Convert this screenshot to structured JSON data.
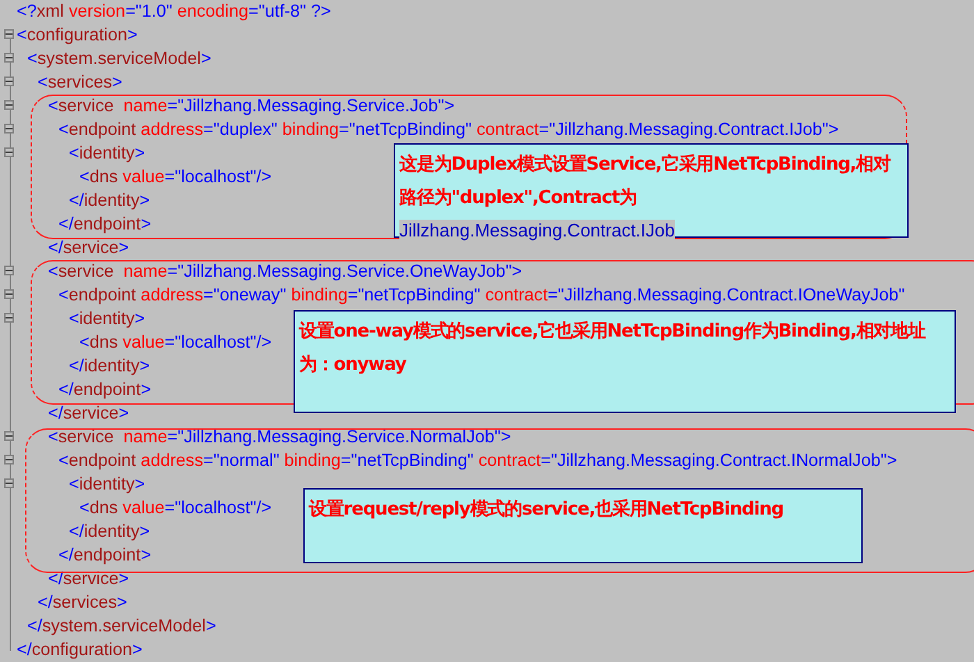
{
  "editor": {
    "lines": [
      {
        "tokens": [
          {
            "kind": "bracket",
            "text": "<?"
          },
          {
            "kind": "tag",
            "text": "xml"
          },
          {
            "kind": "attr",
            "text": " version"
          },
          {
            "kind": "value",
            "text": "=\"1.0\""
          },
          {
            "kind": "attr",
            "text": " encoding"
          },
          {
            "kind": "value",
            "text": "=\"utf-8\""
          },
          {
            "kind": "bracket",
            "text": " ?>"
          }
        ]
      },
      {
        "tokens": [
          {
            "kind": "bracket",
            "text": "<"
          },
          {
            "kind": "tag",
            "text": "configuration"
          },
          {
            "kind": "bracket",
            "text": ">"
          }
        ],
        "expanded": true,
        "children": [
          {
            "tokens": [
              {
                "kind": "bracket",
                "text": "<"
              },
              {
                "kind": "tag",
                "text": "system.serviceModel"
              },
              {
                "kind": "bracket",
                "text": ">"
              }
            ],
            "expanded": true,
            "children": [
              {
                "tokens": [
                  {
                    "kind": "bracket",
                    "text": "<"
                  },
                  {
                    "kind": "tag",
                    "text": "services"
                  },
                  {
                    "kind": "bracket",
                    "text": ">"
                  }
                ],
                "expanded": true,
                "children": [
                  {
                    "tokens": [
                      {
                        "kind": "bracket",
                        "text": "<"
                      },
                      {
                        "kind": "tag",
                        "text": "service"
                      },
                      {
                        "kind": "attr",
                        "text": "  name"
                      },
                      {
                        "kind": "value",
                        "text": "=\"Jillzhang.Messaging.Service.Job\""
                      },
                      {
                        "kind": "bracket",
                        "text": ">"
                      }
                    ],
                    "expanded": true,
                    "children": [
                      {
                        "tokens": [
                          {
                            "kind": "bracket",
                            "text": "<"
                          },
                          {
                            "kind": "tag",
                            "text": "endpoint"
                          },
                          {
                            "kind": "attr",
                            "text": " address"
                          },
                          {
                            "kind": "value",
                            "text": "=\"duplex\""
                          },
                          {
                            "kind": "attr",
                            "text": " binding"
                          },
                          {
                            "kind": "value",
                            "text": "=\"netTcpBinding\""
                          },
                          {
                            "kind": "attr",
                            "text": " contract"
                          },
                          {
                            "kind": "value",
                            "text": "=\"Jillzhang.Messaging.Contract.IJob\""
                          },
                          {
                            "kind": "bracket",
                            "text": ">"
                          }
                        ],
                        "expanded": true,
                        "children": [
                          {
                            "tokens": [
                              {
                                "kind": "bracket",
                                "text": "<"
                              },
                              {
                                "kind": "tag",
                                "text": "identity"
                              },
                              {
                                "kind": "bracket",
                                "text": ">"
                              }
                            ],
                            "expanded": true,
                            "children": [
                              {
                                "tokens": [
                                  {
                                    "kind": "bracket",
                                    "text": "<"
                                  },
                                  {
                                    "kind": "tag",
                                    "text": "dns"
                                  },
                                  {
                                    "kind": "attr",
                                    "text": " value"
                                  },
                                  {
                                    "kind": "value",
                                    "text": "=\"localhost\""
                                  },
                                  {
                                    "kind": "bracket",
                                    "text": "/>"
                                  }
                                ]
                              }
                            ]
                          },
                          {
                            "tokens": [
                              {
                                "kind": "bracket",
                                "text": "</"
                              },
                              {
                                "kind": "tag",
                                "text": "identity"
                              },
                              {
                                "kind": "bracket",
                                "text": ">"
                              }
                            ]
                          }
                        ]
                      },
                      {
                        "tokens": [
                          {
                            "kind": "bracket",
                            "text": "</"
                          },
                          {
                            "kind": "tag",
                            "text": "endpoint"
                          },
                          {
                            "kind": "bracket",
                            "text": ">"
                          }
                        ]
                      }
                    ]
                  },
                  {
                    "tokens": [
                      {
                        "kind": "bracket",
                        "text": "</"
                      },
                      {
                        "kind": "tag",
                        "text": "service"
                      },
                      {
                        "kind": "bracket",
                        "text": ">"
                      }
                    ]
                  },
                  {
                    "tokens": [
                      {
                        "kind": "bracket",
                        "text": "<"
                      },
                      {
                        "kind": "tag",
                        "text": "service"
                      },
                      {
                        "kind": "attr",
                        "text": "  name"
                      },
                      {
                        "kind": "value",
                        "text": "=\"Jillzhang.Messaging.Service.OneWayJob\""
                      },
                      {
                        "kind": "bracket",
                        "text": ">"
                      }
                    ],
                    "expanded": true,
                    "children": [
                      {
                        "tokens": [
                          {
                            "kind": "bracket",
                            "text": "<"
                          },
                          {
                            "kind": "tag",
                            "text": "endpoint"
                          },
                          {
                            "kind": "attr",
                            "text": " address"
                          },
                          {
                            "kind": "value",
                            "text": "=\"oneway\""
                          },
                          {
                            "kind": "attr",
                            "text": " binding"
                          },
                          {
                            "kind": "value",
                            "text": "=\"netTcpBinding\""
                          },
                          {
                            "kind": "attr",
                            "text": " contract"
                          },
                          {
                            "kind": "value",
                            "text": "=\"Jillzhang.Messaging.Contract.IOneWayJob\""
                          }
                        ],
                        "expanded": true,
                        "children": [
                          {
                            "tokens": [
                              {
                                "kind": "bracket",
                                "text": "<"
                              },
                              {
                                "kind": "tag",
                                "text": "identity"
                              },
                              {
                                "kind": "bracket",
                                "text": ">"
                              }
                            ],
                            "expanded": true,
                            "children": [
                              {
                                "tokens": [
                                  {
                                    "kind": "bracket",
                                    "text": "<"
                                  },
                                  {
                                    "kind": "tag",
                                    "text": "dns"
                                  },
                                  {
                                    "kind": "attr",
                                    "text": " value"
                                  },
                                  {
                                    "kind": "value",
                                    "text": "=\"localhost\""
                                  },
                                  {
                                    "kind": "bracket",
                                    "text": "/>"
                                  }
                                ]
                              }
                            ]
                          },
                          {
                            "tokens": [
                              {
                                "kind": "bracket",
                                "text": "</"
                              },
                              {
                                "kind": "tag",
                                "text": "identity"
                              },
                              {
                                "kind": "bracket",
                                "text": ">"
                              }
                            ]
                          }
                        ]
                      },
                      {
                        "tokens": [
                          {
                            "kind": "bracket",
                            "text": "</"
                          },
                          {
                            "kind": "tag",
                            "text": "endpoint"
                          },
                          {
                            "kind": "bracket",
                            "text": ">"
                          }
                        ]
                      }
                    ]
                  },
                  {
                    "tokens": [
                      {
                        "kind": "bracket",
                        "text": "</"
                      },
                      {
                        "kind": "tag",
                        "text": "service"
                      },
                      {
                        "kind": "bracket",
                        "text": ">"
                      }
                    ]
                  },
                  {
                    "tokens": [
                      {
                        "kind": "bracket",
                        "text": "<"
                      },
                      {
                        "kind": "tag",
                        "text": "service"
                      },
                      {
                        "kind": "attr",
                        "text": "  name"
                      },
                      {
                        "kind": "value",
                        "text": "=\"Jillzhang.Messaging.Service.NormalJob\""
                      },
                      {
                        "kind": "bracket",
                        "text": ">"
                      }
                    ],
                    "expanded": true,
                    "children": [
                      {
                        "tokens": [
                          {
                            "kind": "bracket",
                            "text": "<"
                          },
                          {
                            "kind": "tag",
                            "text": "endpoint"
                          },
                          {
                            "kind": "attr",
                            "text": " address"
                          },
                          {
                            "kind": "value",
                            "text": "=\"normal\""
                          },
                          {
                            "kind": "attr",
                            "text": " binding"
                          },
                          {
                            "kind": "value",
                            "text": "=\"netTcpBinding\""
                          },
                          {
                            "kind": "attr",
                            "text": " contract"
                          },
                          {
                            "kind": "value",
                            "text": "=\"Jillzhang.Messaging.Contract.INormalJob\""
                          },
                          {
                            "kind": "bracket",
                            "text": ">"
                          }
                        ],
                        "expanded": true,
                        "children": [
                          {
                            "tokens": [
                              {
                                "kind": "bracket",
                                "text": "<"
                              },
                              {
                                "kind": "tag",
                                "text": "identity"
                              },
                              {
                                "kind": "bracket",
                                "text": ">"
                              }
                            ],
                            "expanded": true,
                            "children": [
                              {
                                "tokens": [
                                  {
                                    "kind": "bracket",
                                    "text": "<"
                                  },
                                  {
                                    "kind": "tag",
                                    "text": "dns"
                                  },
                                  {
                                    "kind": "attr",
                                    "text": " value"
                                  },
                                  {
                                    "kind": "value",
                                    "text": "=\"localhost\""
                                  },
                                  {
                                    "kind": "bracket",
                                    "text": "/>"
                                  }
                                ]
                              }
                            ]
                          },
                          {
                            "tokens": [
                              {
                                "kind": "bracket",
                                "text": "</"
                              },
                              {
                                "kind": "tag",
                                "text": "identity"
                              },
                              {
                                "kind": "bracket",
                                "text": ">"
                              }
                            ]
                          }
                        ]
                      },
                      {
                        "tokens": [
                          {
                            "kind": "bracket",
                            "text": "</"
                          },
                          {
                            "kind": "tag",
                            "text": "endpoint"
                          },
                          {
                            "kind": "bracket",
                            "text": ">"
                          }
                        ]
                      }
                    ]
                  },
                  {
                    "tokens": [
                      {
                        "kind": "bracket",
                        "text": "</"
                      },
                      {
                        "kind": "tag",
                        "text": "service"
                      },
                      {
                        "kind": "bracket",
                        "text": ">"
                      }
                    ]
                  }
                ]
              },
              {
                "tokens": [
                  {
                    "kind": "bracket",
                    "text": "</"
                  },
                  {
                    "kind": "tag",
                    "text": "services"
                  },
                  {
                    "kind": "bracket",
                    "text": ">"
                  }
                ]
              }
            ]
          },
          {
            "tokens": [
              {
                "kind": "bracket",
                "text": "</"
              },
              {
                "kind": "tag",
                "text": "system.serviceModel"
              },
              {
                "kind": "bracket",
                "text": ">"
              }
            ]
          }
        ]
      },
      {
        "tokens": [
          {
            "kind": "bracket",
            "text": "</"
          },
          {
            "kind": "tag",
            "text": "configuration"
          },
          {
            "kind": "bracket",
            "text": ">"
          }
        ]
      }
    ]
  },
  "callouts": [
    {
      "segments": [
        {
          "kind": "note",
          "text": "这是为Duplex模式设置Service,它采用NetTcpBinding,相对路径为\"duplex\",Contract为"
        },
        {
          "kind": "code",
          "text": "Jillzhang.Messaging.Contract.IJob"
        }
      ]
    },
    {
      "segments": [
        {
          "kind": "note",
          "text": "设置one-way模式的service,它也采用NetTcpBinding作为Binding,相对地址为：onyway"
        }
      ]
    },
    {
      "segments": [
        {
          "kind": "note",
          "text": "设置request/reply模式的service,也采用NetTcpBinding"
        }
      ]
    }
  ]
}
